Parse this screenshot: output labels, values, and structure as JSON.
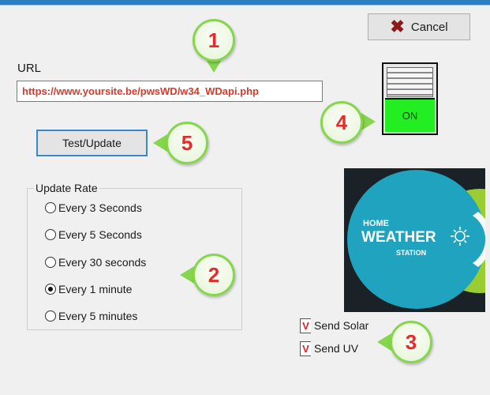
{
  "window": {
    "accent_color": "#2a7fc4"
  },
  "cancel_button": {
    "label": "Cancel",
    "icon": "x-icon",
    "icon_color": "#8b1a1a"
  },
  "url": {
    "label": "URL",
    "value": "https://www.yoursite.be/pwsWD/w34_WDapi.php",
    "value_color": "#d83a2a"
  },
  "test_button": {
    "label": "Test/Update"
  },
  "update_rate": {
    "title": "Update Rate",
    "options": [
      {
        "label": "Every 3 Seconds",
        "selected": false
      },
      {
        "label": "Every 5 Seconds",
        "selected": false
      },
      {
        "label": "Every 30 seconds",
        "selected": false
      },
      {
        "label": "Every 1 minute",
        "selected": true
      },
      {
        "label": "Every 5 minutes",
        "selected": false
      }
    ]
  },
  "power_switch": {
    "state_label": "ON",
    "on_color": "#22ee22"
  },
  "logo": {
    "line1": "HOME",
    "line2": "WEATHER",
    "line3": "STATION",
    "circle_color": "#1fa3bf",
    "accent_color": "#9acd32"
  },
  "checkboxes": [
    {
      "mark": "V",
      "label": "Send Solar",
      "checked": true
    },
    {
      "mark": "V",
      "label": "Send UV",
      "checked": true
    }
  ],
  "annotations": {
    "circle_border_color": "#86d64d",
    "number_color": "#e52b2b",
    "markers": [
      "1",
      "2",
      "3",
      "4",
      "5"
    ]
  }
}
